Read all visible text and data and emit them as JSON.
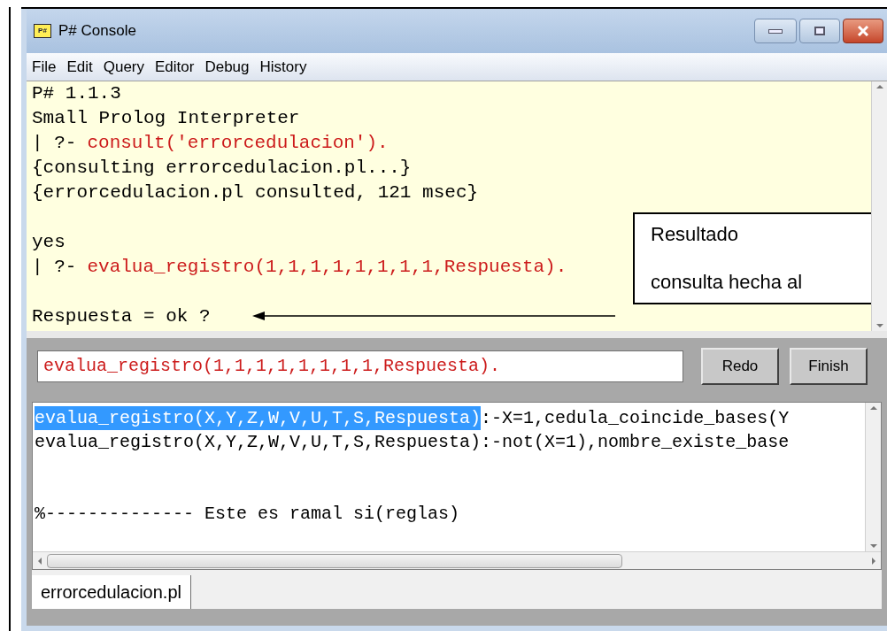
{
  "window": {
    "title": "P# Console",
    "icon_text": "P#"
  },
  "menu": [
    {
      "label": "File"
    },
    {
      "label": "Edit"
    },
    {
      "label": "Query"
    },
    {
      "label": "Editor"
    },
    {
      "label": "Debug"
    },
    {
      "label": "History"
    }
  ],
  "console": {
    "lines": [
      {
        "kind": "output",
        "text": "P# 1.1.3"
      },
      {
        "kind": "output",
        "text": "Small Prolog Interpreter"
      },
      {
        "kind": "query",
        "prompt": "| ?-",
        "text": "consult('errorcedulacion')."
      },
      {
        "kind": "output",
        "text": "{consulting errorcedulacion.pl...}"
      },
      {
        "kind": "output",
        "text": "{errorcedulacion.pl consulted, 121 msec}"
      },
      {
        "kind": "blank"
      },
      {
        "kind": "output",
        "text": "yes"
      },
      {
        "kind": "query",
        "prompt": "| ?-",
        "text": "evalua_registro(1,1,1,1,1,1,1,1,Respuesta)."
      },
      {
        "kind": "blank"
      },
      {
        "kind": "output",
        "text": "Respuesta = ok ?"
      }
    ],
    "callout": {
      "lines": [
        "Resultado",
        "consulta hecha al"
      ]
    }
  },
  "query_input": {
    "value": "evalua_registro(1,1,1,1,1,1,1,1,Respuesta)."
  },
  "buttons": [
    {
      "label": "Redo"
    },
    {
      "label": "Finish"
    }
  ],
  "editor": {
    "lines": [
      {
        "kind": "code",
        "segments": [
          {
            "text": "evalua_registro(X,Y,Z,W,V,U,T,S,Respuesta)",
            "selected": true
          },
          {
            "text": ":-X=1,cedula_coincide_bases(Y",
            "selected": false
          }
        ]
      },
      {
        "kind": "code",
        "segments": [
          {
            "text": "evalua_registro(X,Y,Z,W,V,U,T,S,Respuesta):-not(X=1),nombre_existe_base",
            "selected": false
          }
        ]
      },
      {
        "kind": "blank"
      },
      {
        "kind": "blank"
      },
      {
        "kind": "code",
        "segments": [
          {
            "text": "%-------------- Este es ramal si(reglas)",
            "selected": false
          }
        ]
      }
    ]
  },
  "file_tabs": [
    {
      "label": "errorcedulacion.pl",
      "selected": true
    }
  ]
}
